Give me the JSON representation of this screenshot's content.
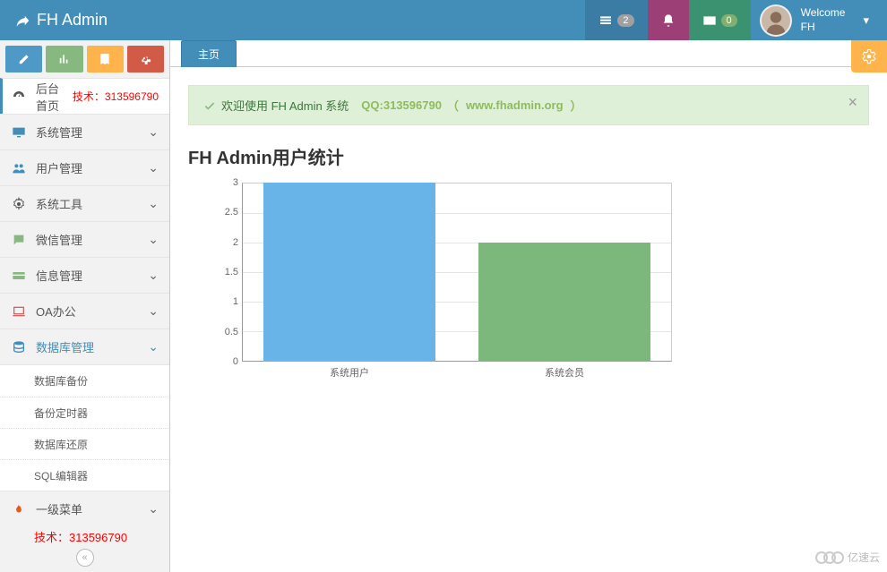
{
  "header": {
    "brand": "FH Admin",
    "tasks_badge": "2",
    "mail_badge": "0",
    "welcome_label": "Welcome",
    "username": "FH"
  },
  "sidebar": {
    "home": {
      "label": "后台首页",
      "tech": "技术：313596790"
    },
    "items": [
      {
        "label": "系统管理"
      },
      {
        "label": "用户管理"
      },
      {
        "label": "系统工具"
      },
      {
        "label": "微信管理"
      },
      {
        "label": "信息管理"
      },
      {
        "label": "OA办公"
      },
      {
        "label": "数据库管理"
      }
    ],
    "db_sub": [
      {
        "label": "数据库备份"
      },
      {
        "label": "备份定时器"
      },
      {
        "label": "数据库还原"
      },
      {
        "label": "SQL编辑器"
      }
    ],
    "level1": {
      "label": "一级菜单"
    },
    "tech_bottom": "技术：313596790"
  },
  "tabs": {
    "main": "主页"
  },
  "alert": {
    "text": "欢迎使用 FH Admin 系统",
    "qq": "QQ:313596790",
    "link_open": "（",
    "link": "www.fhadmin.org",
    "link_close": "）"
  },
  "chart_title": "FH Admin用户统计",
  "chart_data": {
    "type": "bar",
    "categories": [
      "系统用户",
      "系统会员"
    ],
    "values": [
      3,
      2
    ],
    "ylim": [
      0,
      3
    ],
    "yticks": [
      0,
      0.5,
      1,
      1.5,
      2,
      2.5,
      3
    ],
    "title": "FH Admin用户统计",
    "xlabel": "",
    "ylabel": "",
    "colors": [
      "#68b3e7",
      "#7cb77c"
    ]
  },
  "watermark": "亿速云"
}
